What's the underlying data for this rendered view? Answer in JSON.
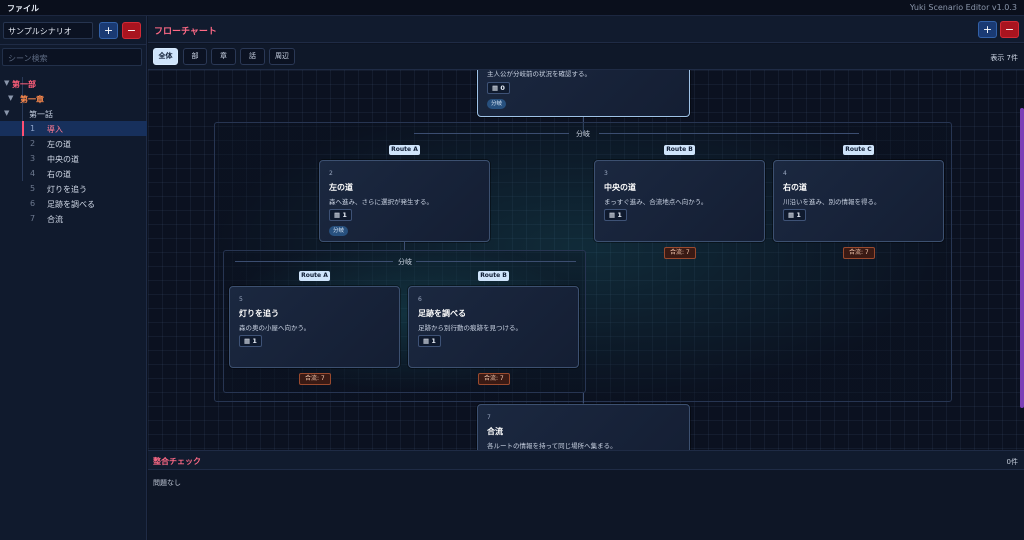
{
  "topbar": {
    "menu_file": "ファイル",
    "app_title": "Yuki Scenario Editor v1.0.3"
  },
  "sidebar": {
    "scenario": "サンプルシナリオ",
    "add": "+",
    "del": "−",
    "search_placeholder": "シーン検索",
    "tree": {
      "part": "第一部",
      "chapter": "第一章",
      "episode": "第一話",
      "scenes": [
        {
          "num": "1",
          "label": "導入"
        },
        {
          "num": "2",
          "label": "左の道"
        },
        {
          "num": "3",
          "label": "中央の道"
        },
        {
          "num": "4",
          "label": "右の道"
        },
        {
          "num": "5",
          "label": "灯りを追う"
        },
        {
          "num": "6",
          "label": "足跡を調べる"
        },
        {
          "num": "7",
          "label": "合流"
        }
      ]
    }
  },
  "main": {
    "title": "フローチャート",
    "add": "+",
    "del": "−",
    "filters": [
      "全体",
      "部",
      "章",
      "話",
      "周辺"
    ],
    "count": "表示 7件"
  },
  "flow": {
    "top_desc": "主人公が分岐前の状況を確認する。",
    "top_chip": "▦ 0",
    "top_branch": "分岐",
    "group1_label": "分岐",
    "group2_label": "分岐",
    "routes": {
      "a": "Route A",
      "b": "Route B",
      "c": "Route C"
    },
    "nodes": {
      "n2": {
        "num": "2",
        "title": "左の道",
        "desc": "森へ進み、さらに選択が発生する。",
        "chip": "▦ 1",
        "branch": "分岐"
      },
      "n3": {
        "num": "3",
        "title": "中央の道",
        "desc": "まっすぐ進み、合流地点へ向かう。",
        "chip": "▦ 1",
        "merge": "合流: 7"
      },
      "n4": {
        "num": "4",
        "title": "右の道",
        "desc": "川沿いを進み、別の情報を得る。",
        "chip": "▦ 1",
        "merge": "合流: 7"
      },
      "n5": {
        "num": "5",
        "title": "灯りを追う",
        "desc": "森の奥の小屋へ向かう。",
        "chip": "▦ 1",
        "merge": "合流: 7"
      },
      "n6": {
        "num": "6",
        "title": "足跡を調べる",
        "desc": "足跡から別行動の痕跡を見つける。",
        "chip": "▦ 1",
        "merge": "合流: 7"
      },
      "n7": {
        "num": "7",
        "title": "合流",
        "desc": "各ルートの情報を持って同じ場所へ集まる。"
      }
    }
  },
  "check": {
    "title": "整合チェック",
    "count": "0件",
    "message": "問題なし"
  },
  "colors": {
    "accent": "#ff6a86",
    "add_button": "#1a3a73",
    "delete_button": "#a8141f",
    "selected": "#17305c"
  }
}
